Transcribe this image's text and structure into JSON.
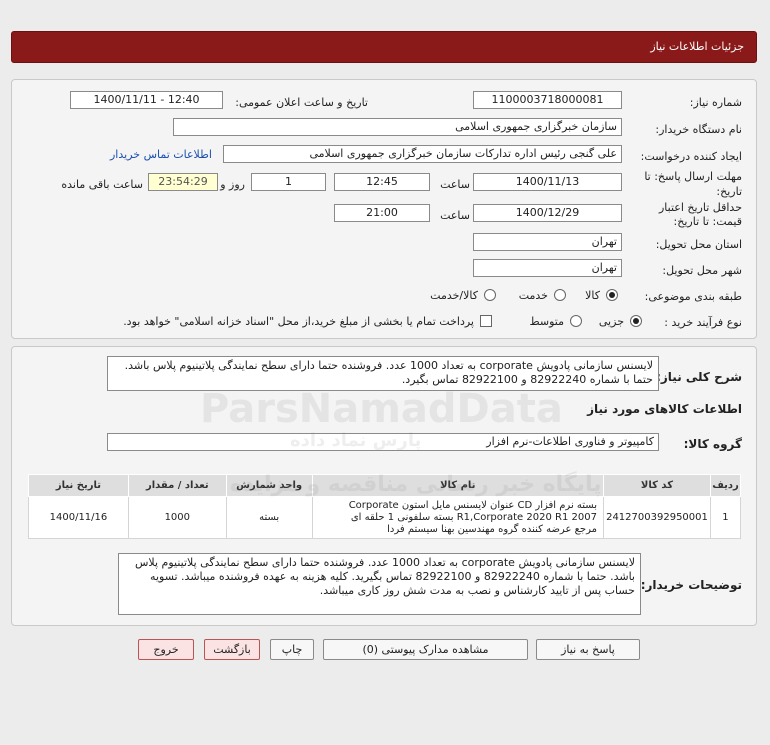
{
  "header": {
    "title": "جزئیات اطلاعات نیاز"
  },
  "form": {
    "need_number_label": "شماره نیاز:",
    "need_number": "1100003718000081",
    "announce_label": "تاریخ و ساعت اعلان عمومی:",
    "announce_value": "1400/11/11 - 12:40",
    "buyer_org_label": "نام دستگاه خریدار:",
    "buyer_org": "سازمان خبرگزاری جمهوری اسلامی",
    "creator_label": "ایجاد کننده درخواست:",
    "creator": "علی گنجی رئیس اداره تدارکات سازمان خبرگزاری جمهوری اسلامی",
    "contact_link": "اطلاعات تماس خریدار",
    "deadline_label_1": "مهلت ارسال پاسخ: تا",
    "deadline_label_2": "تاریخ:",
    "deadline_date": "1400/11/13",
    "time_label": "ساعت",
    "deadline_time": "12:45",
    "days_value": "1",
    "days_label": "روز و",
    "remaining_time": "23:54:29",
    "remaining_label": "ساعت باقی مانده",
    "validity_label_1": "حداقل تاریخ اعتبار",
    "validity_label_2": "قیمت: تا تاریخ:",
    "validity_date": "1400/12/29",
    "validity_time": "21:00",
    "delivery_province_label": "استان محل تحویل:",
    "delivery_province": "تهران",
    "delivery_city_label": "شهر محل تحویل:",
    "delivery_city": "تهران",
    "category_label": "طبقه بندی موضوعی:",
    "category_options": [
      "کالا",
      "خدمت",
      "کالا/خدمت"
    ],
    "purchase_type_label": "نوع فرآیند خرید :",
    "purchase_options": [
      "جزیی",
      "متوسط"
    ],
    "payment_note": "پرداخت تمام یا بخشی از مبلغ خرید،از محل \"اسناد خزانه اسلامی\" خواهد بود."
  },
  "summary": {
    "label": "شرح کلی نیاز:",
    "text": "لایسنس سازمانی پادویش corporate به تعداد 1000 عدد. فروشنده حتما دارای سطح نمایندگی پلاتینیوم پلاس باشد. حتما با شماره 82922240 و 82922100 تماس بگیرد."
  },
  "goods": {
    "section_title": "اطلاعات کالاهای مورد نیاز",
    "group_label": "گروه کالا:",
    "group_value": "کامپیوتر و فناوری اطلاعات-نرم افزار",
    "columns": [
      "ردیف",
      "کد کالا",
      "نام کالا",
      "واحد شمارش",
      "تعداد / مقدار",
      "تاریخ نیاز"
    ],
    "rows": [
      {
        "row": "1",
        "code": "2412700392950001",
        "name_line1": "بسته نرم افزار CD عنوان لایسنس مایل استون Corporate",
        "name_line2": "2007 R1,Corporate 2020 R1 بسته سلفونی 1 حلقه ای",
        "name_line3": "مرجع عرضه کننده گروه مهندسین بهنا سیستم فردا",
        "unit": "بسته",
        "qty": "1000",
        "date": "1400/11/16"
      }
    ]
  },
  "buyer_notes": {
    "label": "توضیحات خریدار:",
    "text": "لایسنس سازمانی پادویش corporate به تعداد 1000 عدد. فروشنده حتما دارای سطح نمایندگی پلاتینیوم پلاس باشد. حتما با شماره 82922240 و 82922100 تماس بگیرید. کلیه هزینه به عهده فروشنده میباشد. تسویه حساب پس از تایید کارشناس و نصب به مدت شش روز کاری میباشد."
  },
  "buttons": {
    "reply": "پاسخ به نیاز",
    "view_docs": "مشاهده مدارک پیوستی (0)",
    "print": "چاپ",
    "back": "بازگشت",
    "exit": "خروج"
  },
  "watermark": {
    "brand": "ParsNamadData",
    "line1": "پایگاه خبر رسانی مناقصه و مزایده",
    "line2": "پارس نماد داده"
  },
  "colors": {
    "header_bg": "#8a1a1a",
    "link": "#1a4fb0",
    "timer_bg": "#ffffd2"
  }
}
